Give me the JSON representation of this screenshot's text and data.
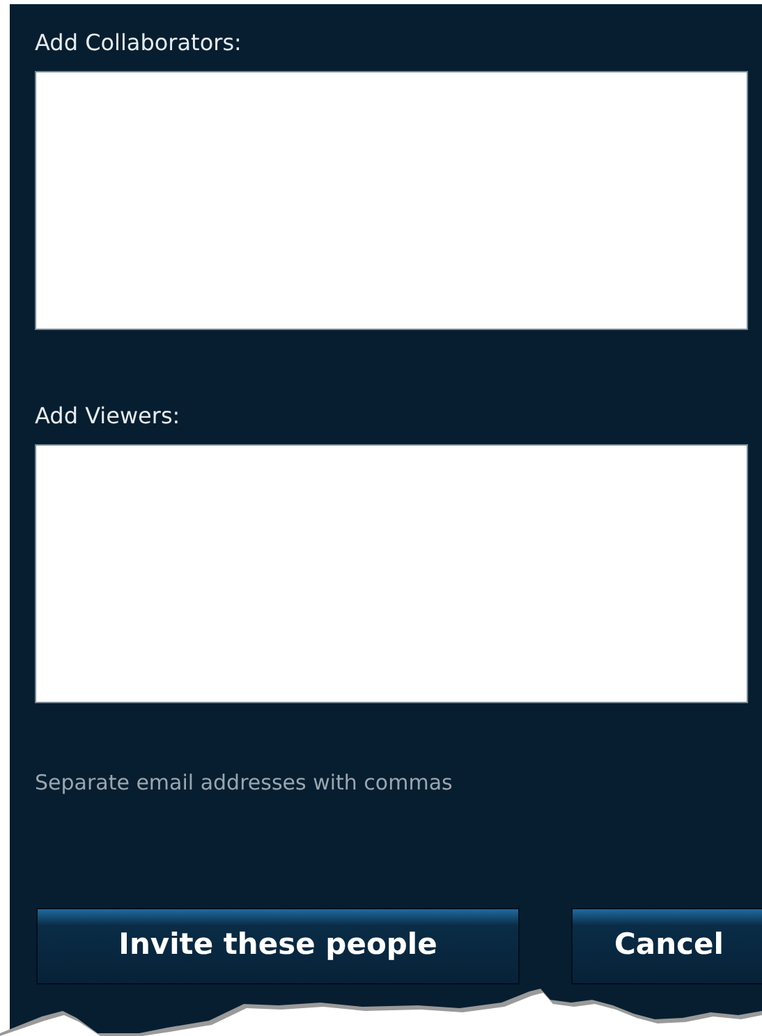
{
  "fields": [
    {
      "label": "Add Collaborators:"
    },
    {
      "label": "Add Viewers:"
    }
  ],
  "hint": "Separate email addresses with commas",
  "buttons": [
    {
      "label": "Invite these people",
      "kind": "primary"
    },
    {
      "label": "Cancel",
      "kind": "secondary"
    }
  ]
}
